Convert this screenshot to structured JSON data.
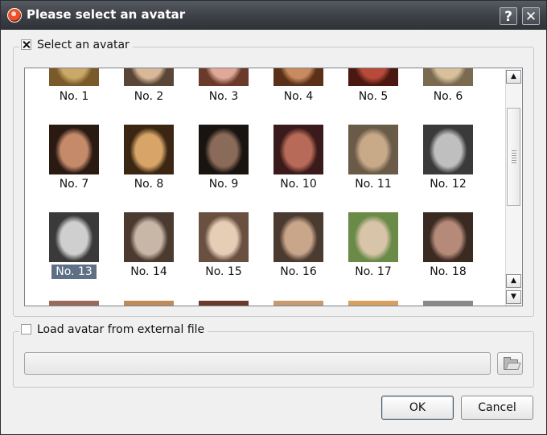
{
  "window": {
    "title": "Please select an avatar"
  },
  "titlebar_buttons": {
    "help": "?",
    "close": "✕"
  },
  "group_select": {
    "label": "Select an avatar",
    "checked": true
  },
  "avatars": {
    "row1": [
      "No. 1",
      "No. 2",
      "No. 3",
      "No. 4",
      "No. 5",
      "No. 6"
    ],
    "row2": [
      "No. 7",
      "No. 8",
      "No. 9",
      "No. 10",
      "No. 11",
      "No. 12"
    ],
    "row3": [
      "No. 13",
      "No. 14",
      "No. 15",
      "No. 16",
      "No. 17",
      "No. 18"
    ],
    "selected": "No. 13"
  },
  "group_external": {
    "label": "Load avatar from external file",
    "checked": false,
    "path_value": ""
  },
  "buttons": {
    "ok": "OK",
    "cancel": "Cancel"
  },
  "icons": {
    "app": "app-logo-icon",
    "browse": "folder-open-icon",
    "scroll_up": "arrow-up-icon",
    "scroll_down": "arrow-down-icon"
  },
  "colors": {
    "titlebar": "#3c4046",
    "selection": "#5f6f86"
  }
}
